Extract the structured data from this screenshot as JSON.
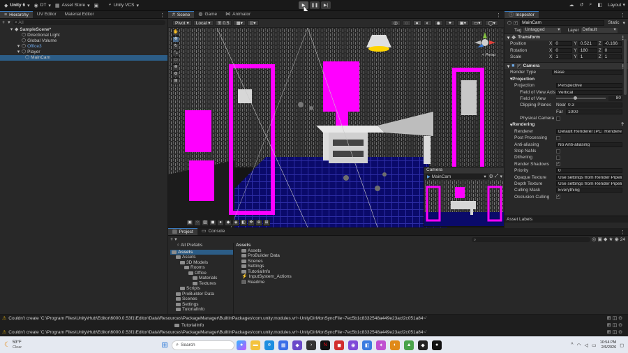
{
  "toolbar": {
    "account": "Unity 6",
    "account_menu": "DT",
    "asset_store": "Asset Store",
    "vcs": "Unity VCS",
    "layout": "Layout"
  },
  "hierarchy": {
    "tab": "Hierarchy",
    "tab2": "UV Editor",
    "tab3": "Material Editor",
    "search_placeholder": "All",
    "items": [
      {
        "label": "SampleScene*",
        "indent": 0,
        "selected": false,
        "bold": true
      },
      {
        "label": "Directional Light",
        "indent": 2,
        "selected": false
      },
      {
        "label": "Global Volume",
        "indent": 2,
        "selected": false
      },
      {
        "label": "Office3",
        "indent": 2,
        "selected": false,
        "blue": true
      },
      {
        "label": "Player",
        "indent": 2,
        "selected": false
      },
      {
        "label": "MainCam",
        "indent": 3,
        "selected": true
      }
    ]
  },
  "scene": {
    "tabs": [
      "Scene",
      "Game",
      "Animator"
    ],
    "pivot": "Pivot",
    "local": "Local",
    "snap": "0.5",
    "persp": "< Persp",
    "overlay_title": "Camera",
    "overlay_cam": "MainCam"
  },
  "inspector": {
    "tab": "Inspector",
    "name": "MainCam",
    "static": "Static",
    "tag_label": "Tag",
    "tag": "Untagged",
    "layer_label": "Layer",
    "layer": "Default",
    "transform": {
      "title": "Transform",
      "rows": [
        {
          "label": "Position",
          "x": "0",
          "y": "0.521",
          "z": "-0.166"
        },
        {
          "label": "Rotation",
          "x": "0",
          "y": "180",
          "z": "0"
        },
        {
          "label": "Scale",
          "x": "1",
          "y": "1",
          "z": "1"
        }
      ]
    },
    "camera": {
      "title": "Camera",
      "render_type_label": "Render Type",
      "render_type": "Base",
      "projection_header": "Projection",
      "projection_label": "Projection",
      "projection": "Perspective",
      "fov_axis_label": "Field of View Axis",
      "fov_axis": "Vertical",
      "fov_label": "Field of View",
      "fov": "80",
      "clip_label": "Clipping Planes",
      "near_label": "Near",
      "near": "0.3",
      "far_label": "Far",
      "far": "1000",
      "physical_label": "Physical Camera",
      "rendering_header": "Rendering",
      "renderer_label": "Renderer",
      "renderer": "Default Renderer (PC_Renderer)",
      "postproc_label": "Post Processing",
      "aa_label": "Anti-aliasing",
      "aa": "No Anti-aliasing",
      "stopnan_label": "Stop NaNs",
      "dither_label": "Dithering",
      "shadows_label": "Render Shadows",
      "priority_label": "Priority",
      "priority": "0",
      "opaque_label": "Opaque Texture",
      "opaque": "Use settings from Render Pipeli",
      "depth_label": "Depth Texture",
      "depth": "Use settings from Render Pipeli",
      "culling_label": "Culling Mask",
      "culling": "Everything",
      "occlusion_label": "Occlusion Culling"
    },
    "asset_labels": "Asset Labels"
  },
  "project": {
    "tab1": "Project",
    "tab2": "Console",
    "all_prefabs": "All Prefabs",
    "count": "24",
    "tree": [
      {
        "label": "Assets",
        "indent": 0,
        "bold": true
      },
      {
        "label": "Assets",
        "indent": 1
      },
      {
        "label": "3D Models",
        "indent": 2
      },
      {
        "label": "Rooms",
        "indent": 3
      },
      {
        "label": "Office",
        "indent": 4
      },
      {
        "label": "Materials",
        "indent": 5
      },
      {
        "label": "Textures",
        "indent": 5
      },
      {
        "label": "Scripts",
        "indent": 2
      },
      {
        "label": "ProBuilder Data",
        "indent": 1
      },
      {
        "label": "Scenes",
        "indent": 1
      },
      {
        "label": "Settings",
        "indent": 1
      },
      {
        "label": "TutorialInfo",
        "indent": 1
      }
    ],
    "breadcrumb": "Assets",
    "assets": [
      "Assets",
      "ProBuilder Data",
      "Scenes",
      "Settings",
      "TutorialInfo",
      "InputSystem_Actions",
      "Readme"
    ]
  },
  "console_msgs": [
    "Couldn't create 'C:\\Program Files\\Unity\\Hub\\Editor\\6000.0.53f1\\Editor\\Data\\Resources\\PackageManager\\BuiltInPackages\\com.unity.modules.vr\\~UnityDirMonSyncFile~7ec5b1c8332548a449e23acf2c051a84~'",
    "TutorialInfo",
    "Couldn't create 'C:\\Program Files\\Unity\\Hub\\Editor\\6000.0.53f1\\Editor\\Data\\Resources\\PackageManager\\BuiltInPackages\\com.unity.modules.vr\\~UnityDirMonSyncFile~7ec5b1c8332548a449e23acf2c051a84~'"
  ],
  "taskbar": {
    "temp": "53°F",
    "weather": "Clear",
    "search": "Search",
    "time": "10:54 PM",
    "date": "2/6/2026"
  },
  "colors": {
    "magenta": "#ff00ff",
    "select": "#2c5d87",
    "accent": "#3a79bb",
    "warn": "#e7b20d"
  }
}
